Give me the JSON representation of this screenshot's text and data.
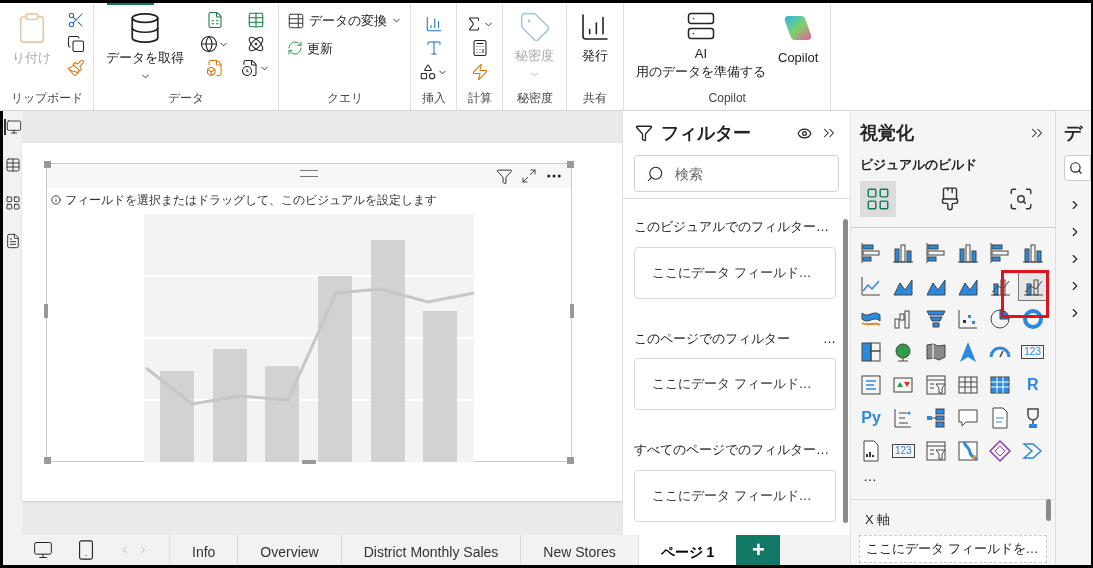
{
  "ribbon": {
    "groups": [
      {
        "kind": "clipboard",
        "label": "リップボード",
        "buttons": [
          {
            "label": "り付け",
            "disabled": true,
            "caret": false
          }
        ]
      },
      {
        "kind": "data",
        "label": "データ",
        "buttons": [
          {
            "label": "データを取得",
            "disabled": false,
            "caret": true
          }
        ]
      },
      {
        "kind": "query",
        "label": "クエリ",
        "buttons": [
          {
            "label": "データの変換",
            "disabled": false,
            "caret": true
          },
          {
            "label": "更新",
            "disabled": false,
            "caret": false
          }
        ]
      },
      {
        "kind": "insert",
        "label": "挿入"
      },
      {
        "kind": "calc",
        "label": "計算"
      },
      {
        "kind": "sensitivity",
        "label": "秘密度",
        "buttons": [
          {
            "label": "秘密度",
            "disabled": true,
            "caret": true
          }
        ]
      },
      {
        "kind": "share",
        "label": "共有",
        "buttons": [
          {
            "label": "発行",
            "disabled": false,
            "caret": false
          }
        ]
      },
      {
        "kind": "copilot",
        "label": "Copilot",
        "buttons": [
          {
            "label": "AI\n用のデータを準備する",
            "disabled": false,
            "caret": false
          },
          {
            "label": "Copilot",
            "disabled": false,
            "caret": false
          }
        ]
      }
    ]
  },
  "view_icons": [
    {
      "selected": true
    },
    {
      "selected": false
    },
    {
      "selected": false
    },
    {
      "selected": false
    }
  ],
  "visual": {
    "hint": "フィールドを選択またはドラッグして、このビジュアルを設定します"
  },
  "filters": {
    "title": "フィルター",
    "search": {
      "placeholder": "検索"
    },
    "sections": [
      {
        "title": "このビジュアルでのフィルター…",
        "field": "ここにデータ フィールド…"
      },
      {
        "title": "このページでのフィルター",
        "more": "…",
        "field": "ここにデータ フィールド…"
      },
      {
        "title": "すべてのページでのフィルター…",
        "field": "ここにデータ フィールド…"
      }
    ]
  },
  "visualizations": {
    "title": "視覚化",
    "subtitle": "ビジュアルのビルド",
    "tabs": [
      {
        "selected": true
      },
      {
        "selected": false
      },
      {
        "selected": false
      }
    ],
    "icons": [
      {
        "kind": "bar",
        "selected": false
      },
      {
        "kind": "column",
        "selected": false
      },
      {
        "kind": "bar",
        "selected": false
      },
      {
        "kind": "column",
        "selected": false
      },
      {
        "kind": "bar",
        "selected": false
      },
      {
        "kind": "column",
        "selected": false
      },
      {
        "kind": "line",
        "selected": false
      },
      {
        "kind": "area",
        "selected": false
      },
      {
        "kind": "area",
        "selected": false
      },
      {
        "kind": "area",
        "selected": false
      },
      {
        "kind": "combo",
        "selected": false
      },
      {
        "kind": "combo",
        "selected": true
      },
      {
        "kind": "ribbon",
        "selected": false
      },
      {
        "kind": "waterfall",
        "selected": false
      },
      {
        "kind": "funnel",
        "selected": false
      },
      {
        "kind": "scatter",
        "selected": false
      },
      {
        "kind": "pie",
        "selected": false
      },
      {
        "kind": "donut",
        "selected": false
      },
      {
        "kind": "treemap",
        "selected": false
      },
      {
        "kind": "globe",
        "selected": false
      },
      {
        "kind": "shape",
        "selected": false
      },
      {
        "kind": "arrow",
        "selected": false
      },
      {
        "kind": "gauge",
        "selected": false
      },
      {
        "kind": "card",
        "label": "123",
        "selected": false
      },
      {
        "kind": "list",
        "selected": false
      },
      {
        "kind": "kpi",
        "selected": false
      },
      {
        "kind": "slicer",
        "selected": false
      },
      {
        "kind": "table",
        "selected": false
      },
      {
        "kind": "matrix",
        "selected": false
      },
      {
        "kind": "script",
        "label": "R",
        "selected": false
      },
      {
        "kind": "script",
        "label": "Py",
        "selected": false
      },
      {
        "kind": "influencers",
        "selected": false
      },
      {
        "kind": "tree",
        "selected": false
      },
      {
        "kind": "bubble",
        "selected": false
      },
      {
        "kind": "document",
        "selected": false
      },
      {
        "kind": "trophy",
        "selected": false
      },
      {
        "kind": "report",
        "selected": false
      },
      {
        "kind": "card",
        "label": "123",
        "selected": false
      },
      {
        "kind": "slicer",
        "selected": false
      },
      {
        "kind": "map",
        "selected": false
      },
      {
        "kind": "diamond",
        "selected": false
      },
      {
        "kind": "chevron",
        "selected": false
      }
    ],
    "more": "…",
    "well": {
      "label": "X 軸",
      "placeholder": "ここにデータ フィールドを…"
    }
  },
  "data_pane": {
    "title": "デ",
    "items": [
      {
        "expanded": false
      },
      {
        "expanded": false
      },
      {
        "expanded": false
      },
      {
        "expanded": false
      },
      {
        "expanded": false
      }
    ]
  },
  "page_tabs": [
    {
      "label": "Info",
      "selected": false
    },
    {
      "label": "Overview",
      "selected": false
    },
    {
      "label": "District Monthly Sales",
      "selected": false
    },
    {
      "label": "New Stores",
      "selected": false
    },
    {
      "label": "ページ 1",
      "selected": true
    }
  ],
  "add_page": "+"
}
